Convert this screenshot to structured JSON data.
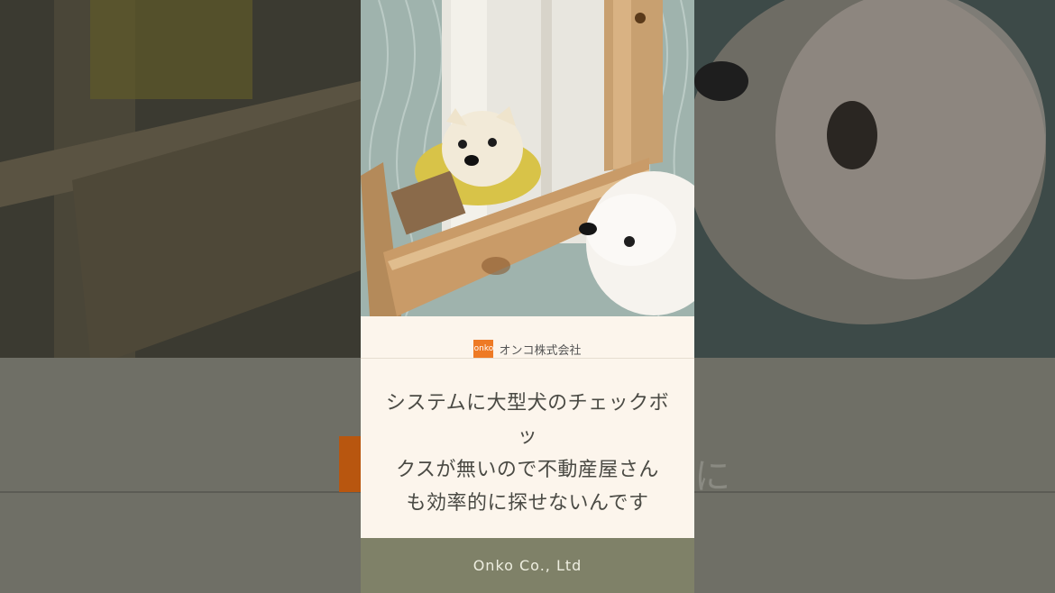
{
  "brand": {
    "logo_text": "onko",
    "name": "オンコ株式会社"
  },
  "message": {
    "lines": [
      "システムに大型犬のチェックボッ",
      "クスが無いので不動産屋さん",
      "も効率的に探せないんです"
    ]
  },
  "footer": {
    "company": "Onko Co., Ltd"
  },
  "background": {
    "partial_char": "に"
  },
  "colors": {
    "brand_orange": "#ee7a25",
    "card_bg": "#fcf5ec",
    "footer_bg": "#7f8168"
  }
}
